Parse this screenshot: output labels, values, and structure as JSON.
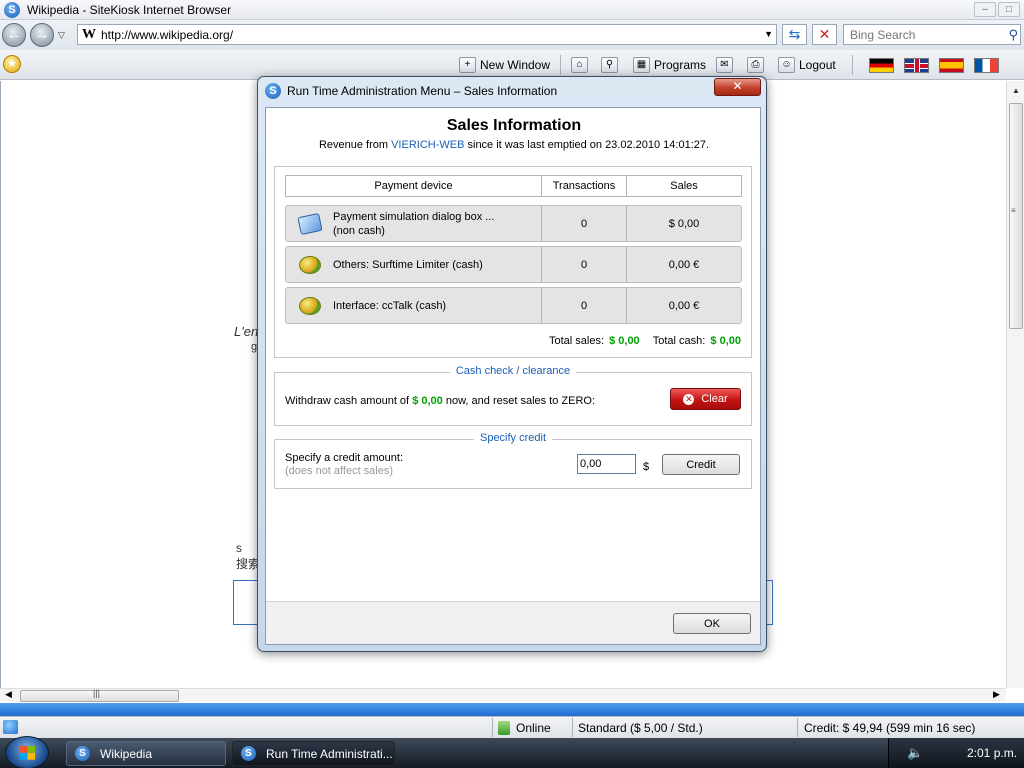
{
  "window": {
    "title": "Wikipedia - SiteKiosk Internet Browser"
  },
  "address": {
    "url": "http://www.wikipedia.org/",
    "site_logo": "W"
  },
  "search": {
    "placeholder": "Bing Search"
  },
  "toolbar": {
    "new_window": "New Window",
    "programs": "Programs",
    "logout": "Logout",
    "languages": [
      "German",
      "English",
      "Spanish",
      "French"
    ]
  },
  "page": {
    "partial_text_1": "L'en",
    "partial_text_2": "g",
    "partial_text_3": "s",
    "partial_text_4": "搜索"
  },
  "dialog": {
    "title": "Run Time Administration Menu – Sales Information",
    "close_label": "✕",
    "heading": "Sales Information",
    "revenue_prefix": "Revenue from",
    "terminal": "VIERICH-WEB",
    "revenue_suffix": "since it was last emptied on 23.02.2010 14:01:27.",
    "table": {
      "headers": [
        "Payment device",
        "Transactions",
        "Sales"
      ],
      "rows": [
        {
          "device": "Payment simulation dialog box ...",
          "device_sub": "(non cash)",
          "transactions": "0",
          "sales": "$ 0,00",
          "icon": "card-icon"
        },
        {
          "device": "Others: Surftime Limiter (cash)",
          "device_sub": "",
          "transactions": "0",
          "sales": "0,00 €",
          "icon": "coins-icon"
        },
        {
          "device": "Interface: ccTalk (cash)",
          "device_sub": "",
          "transactions": "0",
          "sales": "0,00 €",
          "icon": "coins-icon"
        }
      ]
    },
    "totals": {
      "sales_label": "Total sales:",
      "sales_value": "$ 0,00",
      "cash_label": "Total cash:",
      "cash_value": "$ 0,00"
    },
    "cash_check": {
      "legend": "Cash check / clearance",
      "text_prefix": "Withdraw cash amount of",
      "amount": "$ 0,00",
      "text_suffix": "now, and reset sales to ZERO:",
      "clear_label": "Clear"
    },
    "credit": {
      "legend": "Specify credit",
      "label": "Specify a credit amount:",
      "hint": "(does not affect sales)",
      "value": "0,00",
      "currency": "$",
      "button": "Credit"
    },
    "ok_label": "OK"
  },
  "status": {
    "online": "Online",
    "tariff": "Standard ($ 5,00 / Std.)",
    "credit": "Credit: $ 49,94 (599 min 16 sec)"
  },
  "taskbar": {
    "tasks": [
      "Wikipedia",
      "Run Time Administrati..."
    ],
    "clock": "2:01 p.m."
  },
  "colors": {
    "accent": "#1a5fb4",
    "money": "#00a000",
    "clear": "#c41414"
  }
}
